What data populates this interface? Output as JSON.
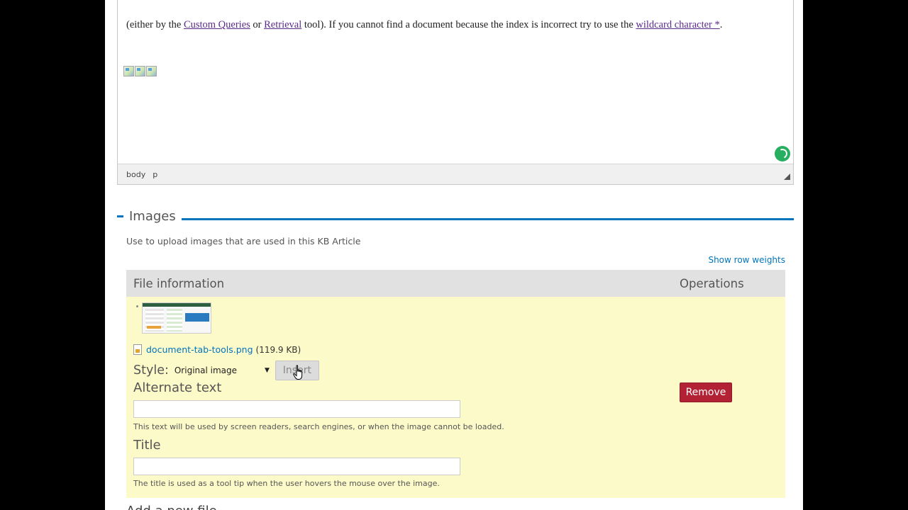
{
  "editor": {
    "text_before": "(either by the ",
    "link_custom_queries": "Custom Queries",
    "text_or": " or ",
    "link_retrieval": "Retrieval",
    "text_middle": " tool).  If you cannot find a document because the index is incorrect try to use the ",
    "link_wildcard": "wildcard character *",
    "text_end": ".",
    "path": [
      "body",
      "p"
    ]
  },
  "images": {
    "legend": "Images",
    "description": "Use to upload images that are used in this KB Article",
    "show_row_weights": "Show row weights",
    "columns": {
      "file": "File information",
      "operations": "Operations"
    },
    "file": {
      "name": "document-tab-tools.png",
      "size": "(119.9 KB)",
      "style_label": "Style:",
      "style_value": "Original image",
      "insert_label": "Insert",
      "alt_label": "Alternate text",
      "alt_value": "",
      "alt_help": "This text will be used by screen readers, search engines, or when the image cannot be loaded.",
      "title_label": "Title",
      "title_value": "",
      "title_help": "The title is used as a tool tip when the user hovers the mouse over the image.",
      "remove_label": "Remove"
    },
    "add_new_file": "Add a new file"
  },
  "colors": {
    "accent": "#0074bd",
    "row_highlight": "#fdfac9",
    "remove": "#b22234",
    "link_visited": "#5b2c8a"
  }
}
